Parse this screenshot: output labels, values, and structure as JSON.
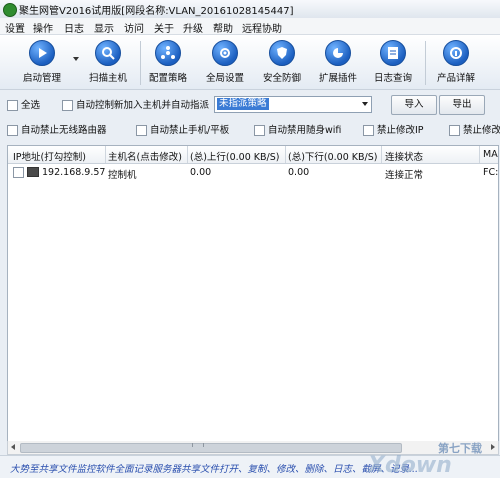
{
  "window": {
    "title": "聚生网管V2016试用版[网段名称:VLAN_20161028145447]"
  },
  "menu": [
    "设置",
    "操作",
    "日志",
    "显示",
    "访问",
    "关于",
    "升级",
    "帮助",
    "远程协助"
  ],
  "toolbar": {
    "items": [
      {
        "label": "启动管理",
        "icon": "play-icon"
      },
      {
        "label": "扫描主机",
        "icon": "scan-icon"
      },
      {
        "label": "配置策略",
        "icon": "policy-icon"
      },
      {
        "label": "全局设置",
        "icon": "settings-icon"
      },
      {
        "label": "安全防御",
        "icon": "shield-icon"
      },
      {
        "label": "扩展插件",
        "icon": "plugin-icon"
      },
      {
        "label": "日志查询",
        "icon": "log-icon"
      },
      {
        "label": "产品详解",
        "icon": "info-icon"
      }
    ]
  },
  "controls": {
    "select_all": "全选",
    "auto_control": "自动控制新加入主机并自动指派",
    "policy_select_value": "未指派策略",
    "import": "导入",
    "export": "导出"
  },
  "options": [
    "自动禁止无线路由器",
    "自动禁止手机/平板",
    "自动禁用随身wifi",
    "禁止修改IP",
    "禁止修改"
  ],
  "table": {
    "headers": [
      "IP地址(打勾控制)",
      "主机名(点击修改)",
      "(总)上行(0.00 KB/S)",
      "(总)下行(0.00 KB/S)",
      "连接状态",
      "MA"
    ],
    "rows": [
      {
        "ip": "192.168.9.57",
        "hostname": "控制机",
        "up": "0.00",
        "down": "0.00",
        "status": "连接正常",
        "mac": "FC:"
      }
    ]
  },
  "status_bar": "大势至共享文件监控软件全面记录服务器共享文件打开、复制、修改、删除、日志、截屏、记录...",
  "watermark": "第七下载",
  "colors": {
    "accent": "#3a7bd5",
    "status_text": "#2a4fae"
  }
}
